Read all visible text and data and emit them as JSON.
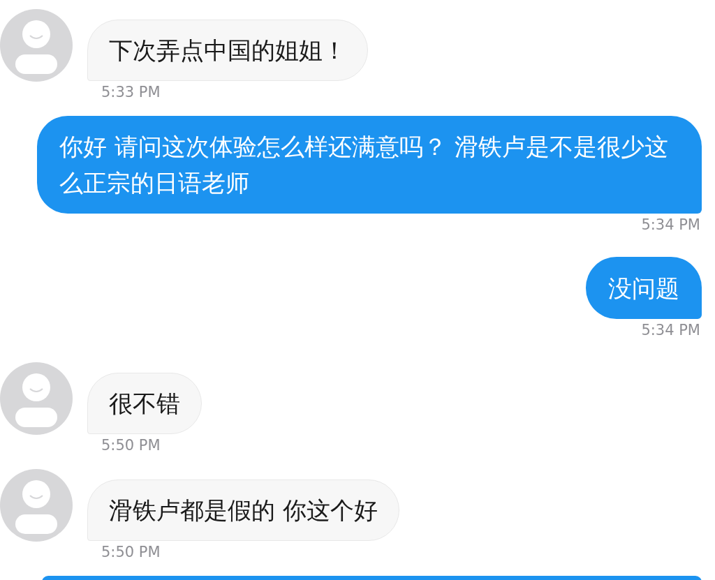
{
  "messages": [
    {
      "kind": "received",
      "text": "下次弄点中国的姐姐！",
      "time": "5:33 PM"
    },
    {
      "kind": "sent",
      "text": "你好 请问这次体验怎么样还满意吗？ 滑铁卢是不是很少这么正宗的日语老师",
      "time": "5:34 PM"
    },
    {
      "kind": "sent",
      "text": "没问题",
      "time": "5:34 PM"
    },
    {
      "kind": "received",
      "text": "很不错",
      "time": "5:50 PM"
    },
    {
      "kind": "received",
      "text": "滑铁卢都是假的 你这个好",
      "time": "5:50 PM"
    },
    {
      "kind": "sent_cut"
    }
  ]
}
